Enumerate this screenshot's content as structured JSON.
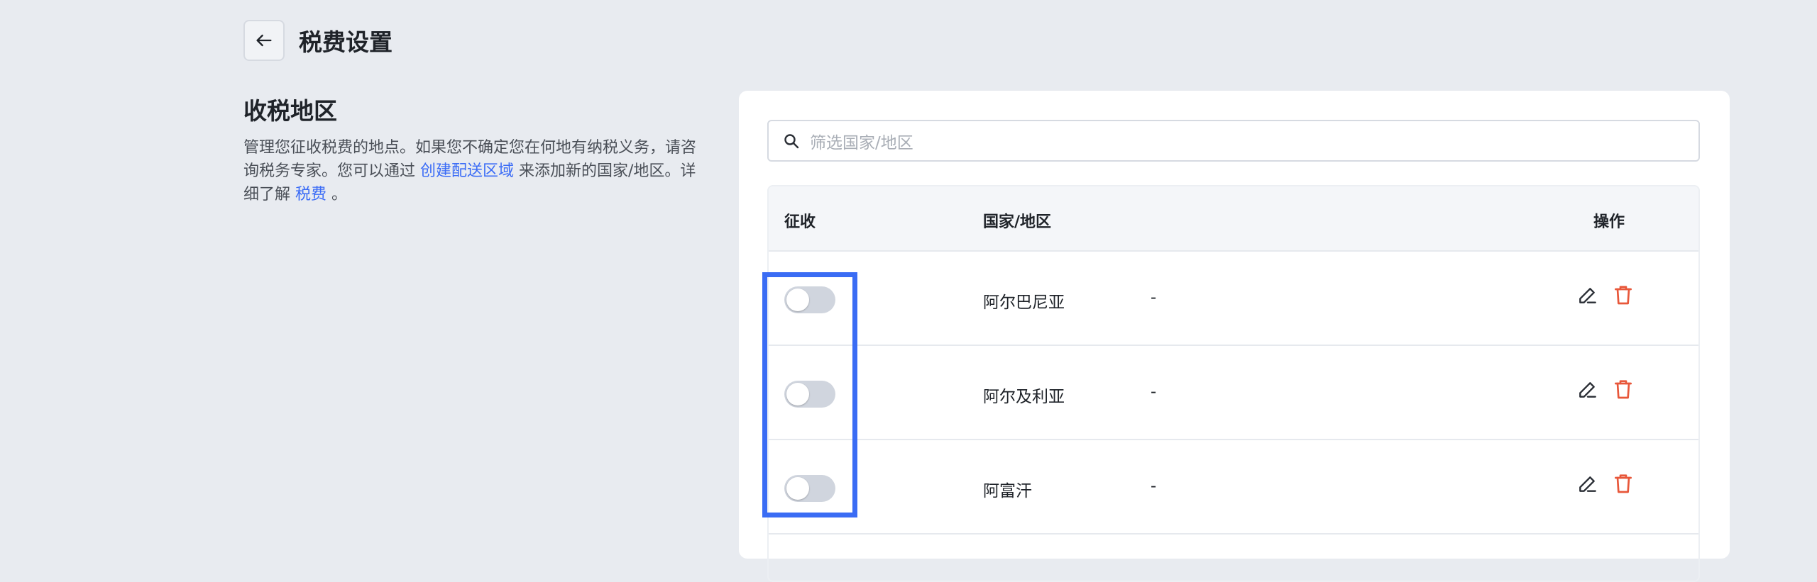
{
  "header": {
    "back_icon": "arrow-left-icon",
    "title": "税费设置"
  },
  "section": {
    "title": "收税地区",
    "desc_line1": "管理您征收税费的地点。如果您不确定您在何地有纳税义务，请咨",
    "desc_line2_pre": "询税务专家。您可以通过 ",
    "desc_link1": "创建配送区域",
    "desc_line2_post": " 来添加新的国家/地区。详",
    "desc_line3_pre": "细了解 ",
    "desc_link2": "税费",
    "desc_line3_post": " 。"
  },
  "search": {
    "icon": "search-icon",
    "placeholder": "筛选国家/地区"
  },
  "table": {
    "headers": {
      "collect": "征收",
      "country": "国家/地区",
      "actions": "操作"
    },
    "rows": [
      {
        "country": "阿尔巴尼亚",
        "rate": "-",
        "enabled": false
      },
      {
        "country": "阿尔及利亚",
        "rate": "-",
        "enabled": false
      },
      {
        "country": "阿富汗",
        "rate": "-",
        "enabled": false
      }
    ]
  },
  "colors": {
    "accent": "#3b6cf6",
    "delete": "#e8573a",
    "highlight": "#3a6cf4",
    "toggle_off": "#d0d5de"
  }
}
